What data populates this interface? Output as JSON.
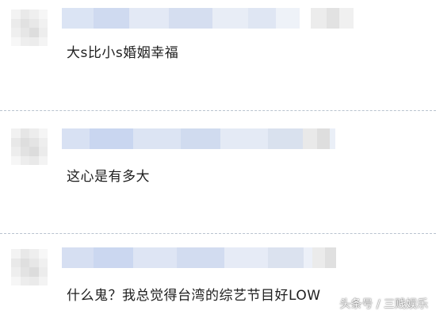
{
  "comments": [
    {
      "text": "大s比小s婚姻幸福"
    },
    {
      "text": "这心是有多大"
    },
    {
      "text": "什么鬼？我总觉得台湾的综艺节目好LOW"
    }
  ],
  "watermark": "头条号 / 三贱娱乐",
  "colors": {
    "mosaic_light": "#eef2f8",
    "mosaic_mid": "#d9e1ee",
    "mosaic_blue": "#c9d6f0",
    "mosaic_gray": "#e4e4e4",
    "divider": "#b9c3cf"
  }
}
